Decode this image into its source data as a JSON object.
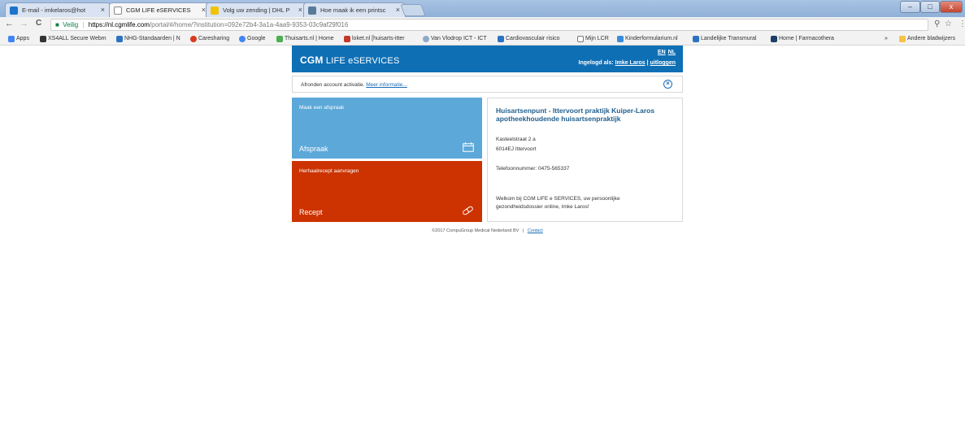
{
  "browser": {
    "tabs": [
      {
        "label": "E-mail - imkelaros@hot",
        "favicon_color": "#1b74c9",
        "active": false
      },
      {
        "label": "CGM LIFE eSERVICES",
        "favicon_color": "#ffffff",
        "active": true
      },
      {
        "label": "Volg uw zending | DHL P",
        "favicon_color": "#f2c200",
        "active": false
      },
      {
        "label": "Hoe maak ik een printsc",
        "favicon_color": "#5a7a9a",
        "active": false
      }
    ],
    "tab_close": "×",
    "window_controls": {
      "minimize": "–",
      "maximize": "□",
      "close": "x"
    },
    "nav": {
      "back": "←",
      "forward": "→",
      "reload": "C"
    },
    "address": {
      "secure_label": "Veilig",
      "host": "https://nl.cgmlife.com",
      "path": "/portal/#/home/?institution=092e72b4-3a1a-4aa9-9353-03c9af29f016"
    },
    "toolbar_icons": {
      "key": "key-icon",
      "star": "☆",
      "menu": "⋮"
    },
    "bookmarks": [
      {
        "label": "Apps",
        "color": "#4285f4"
      },
      {
        "label": "XS4ALL Secure Webm",
        "color": "#333333"
      },
      {
        "label": "NHG-Standaarden | N",
        "color": "#2b73c2"
      },
      {
        "label": "Caresharing",
        "color": "#d93a1e"
      },
      {
        "label": "Google",
        "color": "#4285f4"
      },
      {
        "label": "Thuisarts.nl | Home",
        "color": "#4caf50"
      },
      {
        "label": "loket.nl [huisarts-itter",
        "color": "#c0392b"
      },
      {
        "label": "Van Vlodrop ICT - ICT",
        "color": "#8fa9c9"
      },
      {
        "label": "Cardiovasculair risico",
        "color": "#2b73c2"
      },
      {
        "label": "Mijn LCR",
        "color": "#777777"
      },
      {
        "label": "Kinderformularium.nl",
        "color": "#3a8dd8"
      },
      {
        "label": "Landelijke Transmural",
        "color": "#2b73c2"
      },
      {
        "label": "Home | Farmacothera",
        "color": "#1e3f66"
      }
    ],
    "bookmarks_overflow": "»",
    "other_bookmarks": "Andere bladwijzers"
  },
  "header": {
    "logo_bold": "CGM",
    "logo_rest": "LIFE eSERVICES",
    "lang_en": "EN",
    "lang_nl": "NL",
    "login_prefix": "Ingelogd als:",
    "user_name": "Imke Laros",
    "separator": "|",
    "logout": "uitloggen"
  },
  "notice": {
    "text": "Afronden account activatie.",
    "link": "Meer informatie..."
  },
  "tiles": {
    "afspraak": {
      "subtitle": "Maak een afspraak",
      "title": "Afspraak",
      "icon": "calendar-icon",
      "color": "#5ca8d8"
    },
    "recept": {
      "subtitle": "Herhaalrecept aanvragen",
      "title": "Recept",
      "icon": "pill-icon",
      "color": "#cc3300"
    }
  },
  "practice": {
    "name": "Huisartsenpunt - Ittervoort praktijk Kuiper-Laros apotheekhoudende huisartsenpraktijk",
    "street": "Kasteelstraat 2 a",
    "city": "6014EJ Ittervoort",
    "phone": "Telefoonnummer: 0475-565337",
    "welcome": "Welkom bij CGM LIFE e SERVICES, uw persoonlijke gezondheidsdossier online, Imke Laros!"
  },
  "footer": {
    "copyright": "©2017 CompuGroup Medical Nederland BV",
    "separator": "|",
    "contact": "Contact"
  }
}
